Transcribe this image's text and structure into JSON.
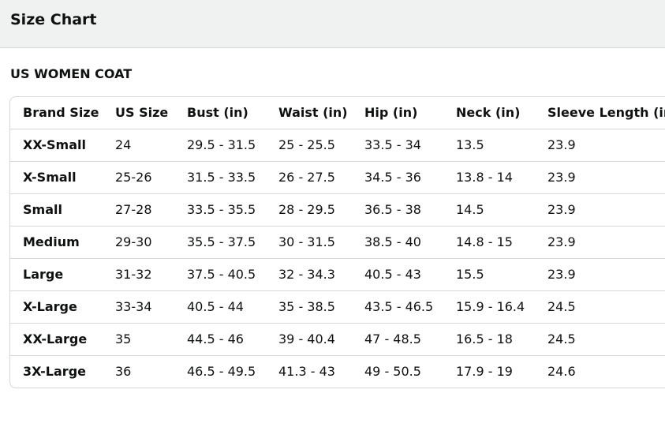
{
  "header": {
    "title": "Size Chart"
  },
  "section": {
    "title": "US WOMEN COAT"
  },
  "table": {
    "columns": [
      "Brand Size",
      "US Size",
      "Bust (in)",
      "Waist (in)",
      "Hip (in)",
      "Neck (in)",
      "Sleeve Length (in)"
    ],
    "rows": [
      [
        "XX-Small",
        "24",
        "29.5 - 31.5",
        "25 - 25.5",
        "33.5 - 34",
        "13.5",
        "23.9"
      ],
      [
        "X-Small",
        "25-26",
        "31.5 - 33.5",
        "26 - 27.5",
        "34.5 - 36",
        "13.8 - 14",
        "23.9"
      ],
      [
        "Small",
        "27-28",
        "33.5 - 35.5",
        "28 - 29.5",
        "36.5 - 38",
        "14.5",
        "23.9"
      ],
      [
        "Medium",
        "29-30",
        "35.5 - 37.5",
        "30 - 31.5",
        "38.5 - 40",
        "14.8 - 15",
        "23.9"
      ],
      [
        "Large",
        "31-32",
        "37.5 - 40.5",
        "32 - 34.3",
        "40.5 - 43",
        "15.5",
        "23.9"
      ],
      [
        "X-Large",
        "33-34",
        "40.5 - 44",
        "35 - 38.5",
        "43.5 - 46.5",
        "15.9 - 16.4",
        "24.5"
      ],
      [
        "XX-Large",
        "35",
        "44.5 - 46",
        "39 - 40.4",
        "47 - 48.5",
        "16.5 - 18",
        "24.5"
      ],
      [
        "3X-Large",
        "36",
        "46.5 - 49.5",
        "41.3 - 43",
        "49 - 50.5",
        "17.9 - 19",
        "24.6"
      ]
    ]
  },
  "colors": {
    "header_bg": "#f0f2f2",
    "border": "#d5d9d9",
    "text": "#0f1111"
  }
}
